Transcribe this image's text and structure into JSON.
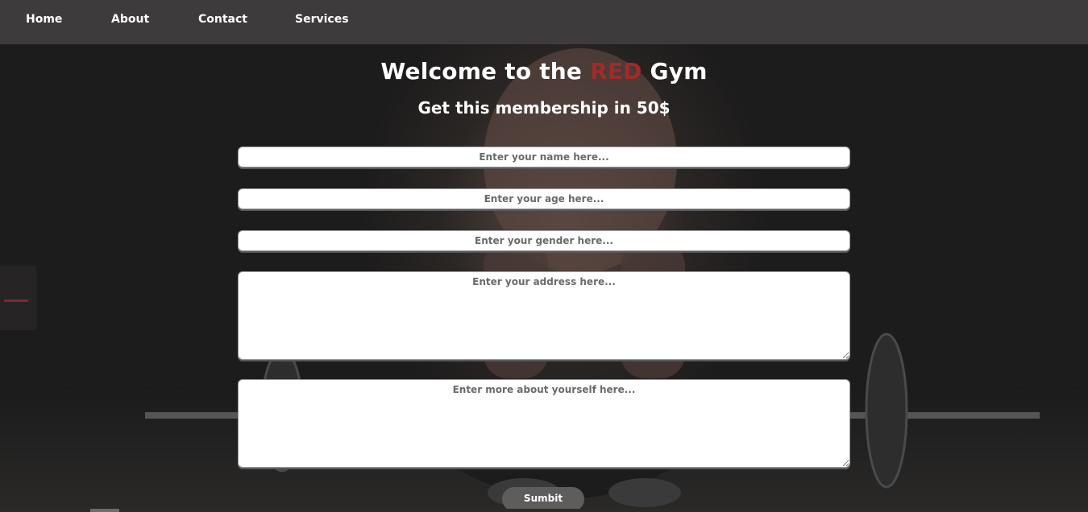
{
  "nav": {
    "items": [
      {
        "label": "Home"
      },
      {
        "label": "About"
      },
      {
        "label": "Contact"
      },
      {
        "label": "Services"
      }
    ]
  },
  "hero": {
    "title_prefix": "Welcome to the ",
    "title_highlight": "RED",
    "title_suffix": " Gym",
    "subtitle": "Get this membership in 50$"
  },
  "form": {
    "name_placeholder": "Enter your name here...",
    "age_placeholder": "Enter your age here...",
    "gender_placeholder": "Enter your gender here...",
    "address_placeholder": "Enter your address here...",
    "about_placeholder": "Enter more about yourself here...",
    "submit_label": "Sumbit"
  },
  "colors": {
    "nav_bg": "#3d3b3b",
    "page_bg": "#1d1c1c",
    "accent_red": "#a12a2a",
    "submit_bg": "#5f5c5c"
  }
}
